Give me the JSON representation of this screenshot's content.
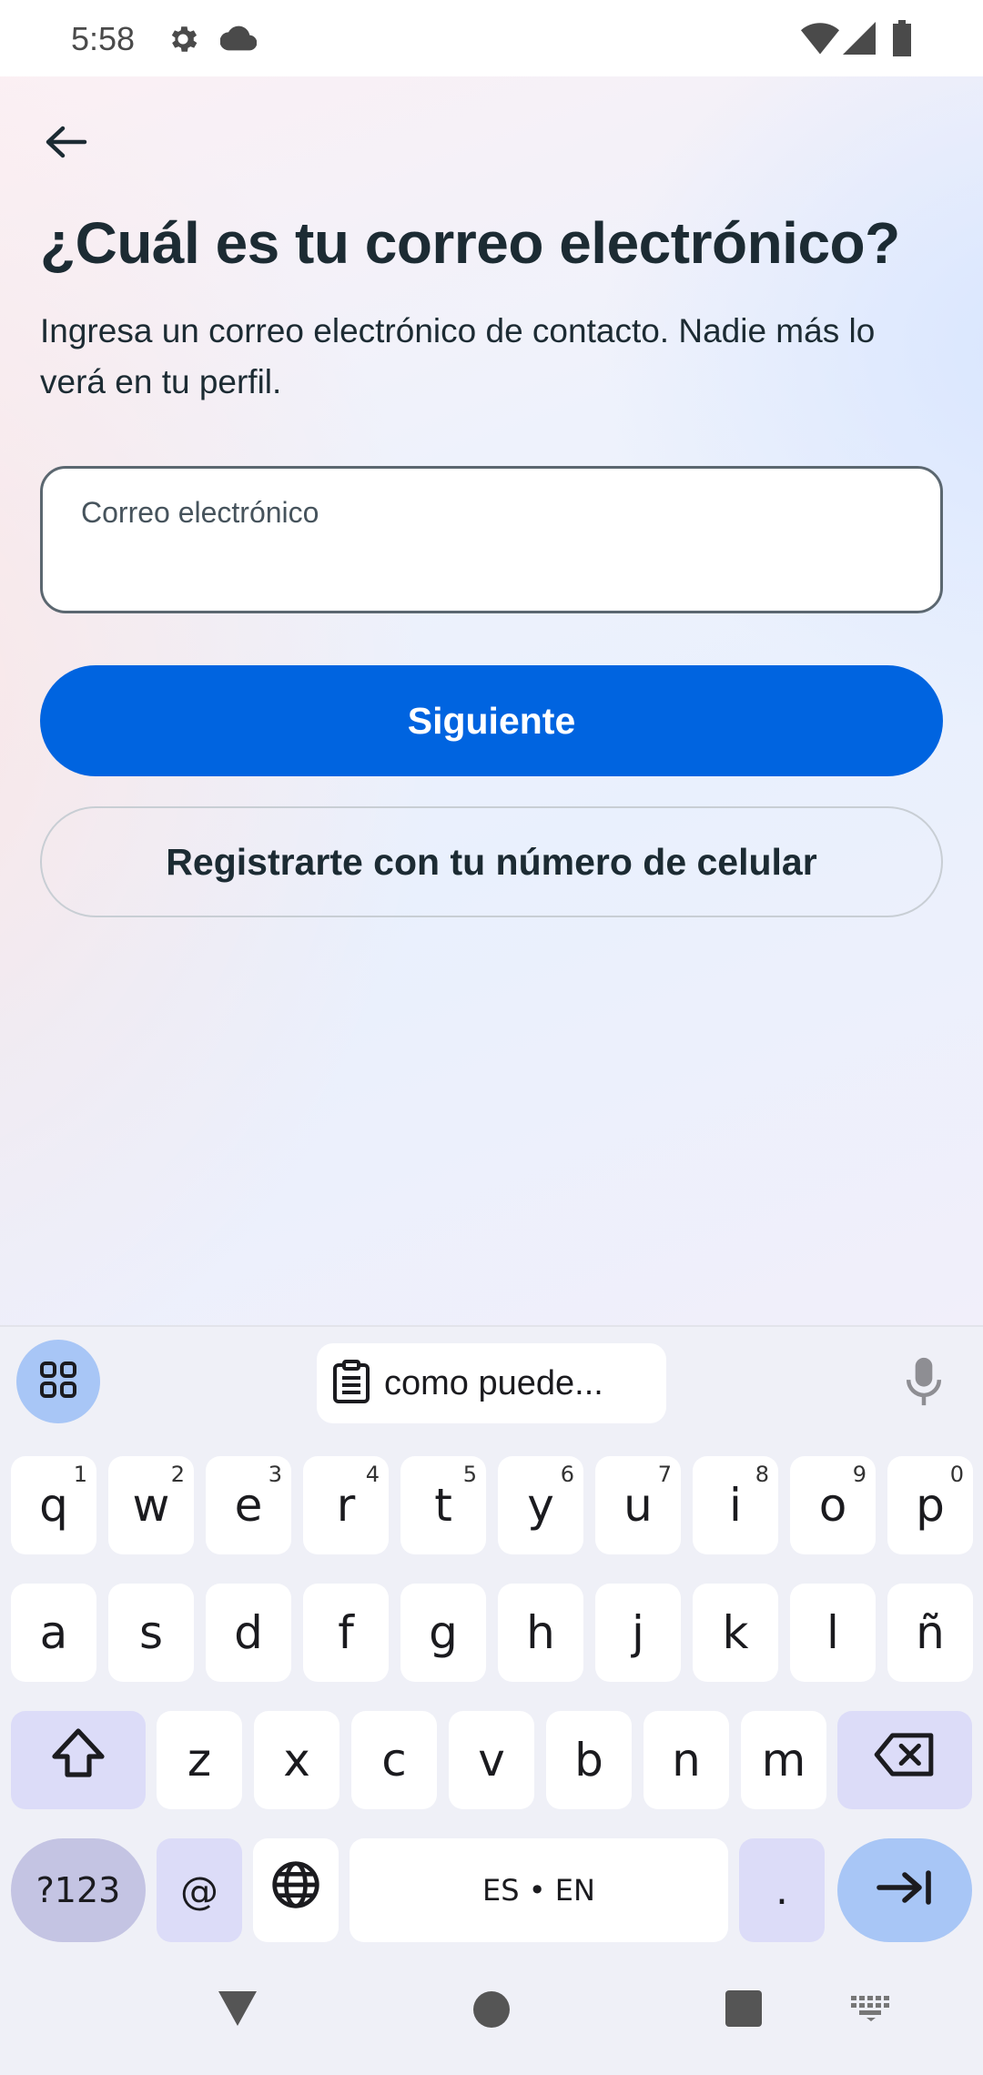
{
  "status_bar": {
    "time": "5:58",
    "icons": [
      "gear-icon",
      "cloud-icon",
      "wifi-icon",
      "signal-icon",
      "battery-icon"
    ]
  },
  "header": {
    "back_icon": "arrow-left-icon"
  },
  "main": {
    "title": "¿Cuál es tu correo electrónico?",
    "subtitle": "Ingresa un correo electrónico de contacto. Nadie más lo verá en tu perfil.",
    "email_field": {
      "label": "Correo electrónico",
      "value": ""
    },
    "next_button": "Siguiente",
    "phone_signup_button": "Registrarte con tu número de celular"
  },
  "keyboard": {
    "clipboard_suggestion": "como puede...",
    "row1": [
      {
        "k": "q",
        "h": "1"
      },
      {
        "k": "w",
        "h": "2"
      },
      {
        "k": "e",
        "h": "3"
      },
      {
        "k": "r",
        "h": "4"
      },
      {
        "k": "t",
        "h": "5"
      },
      {
        "k": "y",
        "h": "6"
      },
      {
        "k": "u",
        "h": "7"
      },
      {
        "k": "i",
        "h": "8"
      },
      {
        "k": "o",
        "h": "9"
      },
      {
        "k": "p",
        "h": "0"
      }
    ],
    "row2": [
      "a",
      "s",
      "d",
      "f",
      "g",
      "h",
      "j",
      "k",
      "l",
      "ñ"
    ],
    "row3": [
      "z",
      "x",
      "c",
      "v",
      "b",
      "n",
      "m"
    ],
    "symbols_key": "?123",
    "at_key": "@",
    "space_key": "ES • EN",
    "period_key": ".",
    "colors": {
      "accent": "#0064e0",
      "keyboard_bg": "#eff0f7",
      "mod_key": "#dcdcf8",
      "action_key": "#a8c6f6"
    }
  },
  "nav_bar": {
    "icons": [
      "back-triangle-icon",
      "home-circle-icon",
      "recents-square-icon",
      "keyboard-switch-icon"
    ]
  }
}
